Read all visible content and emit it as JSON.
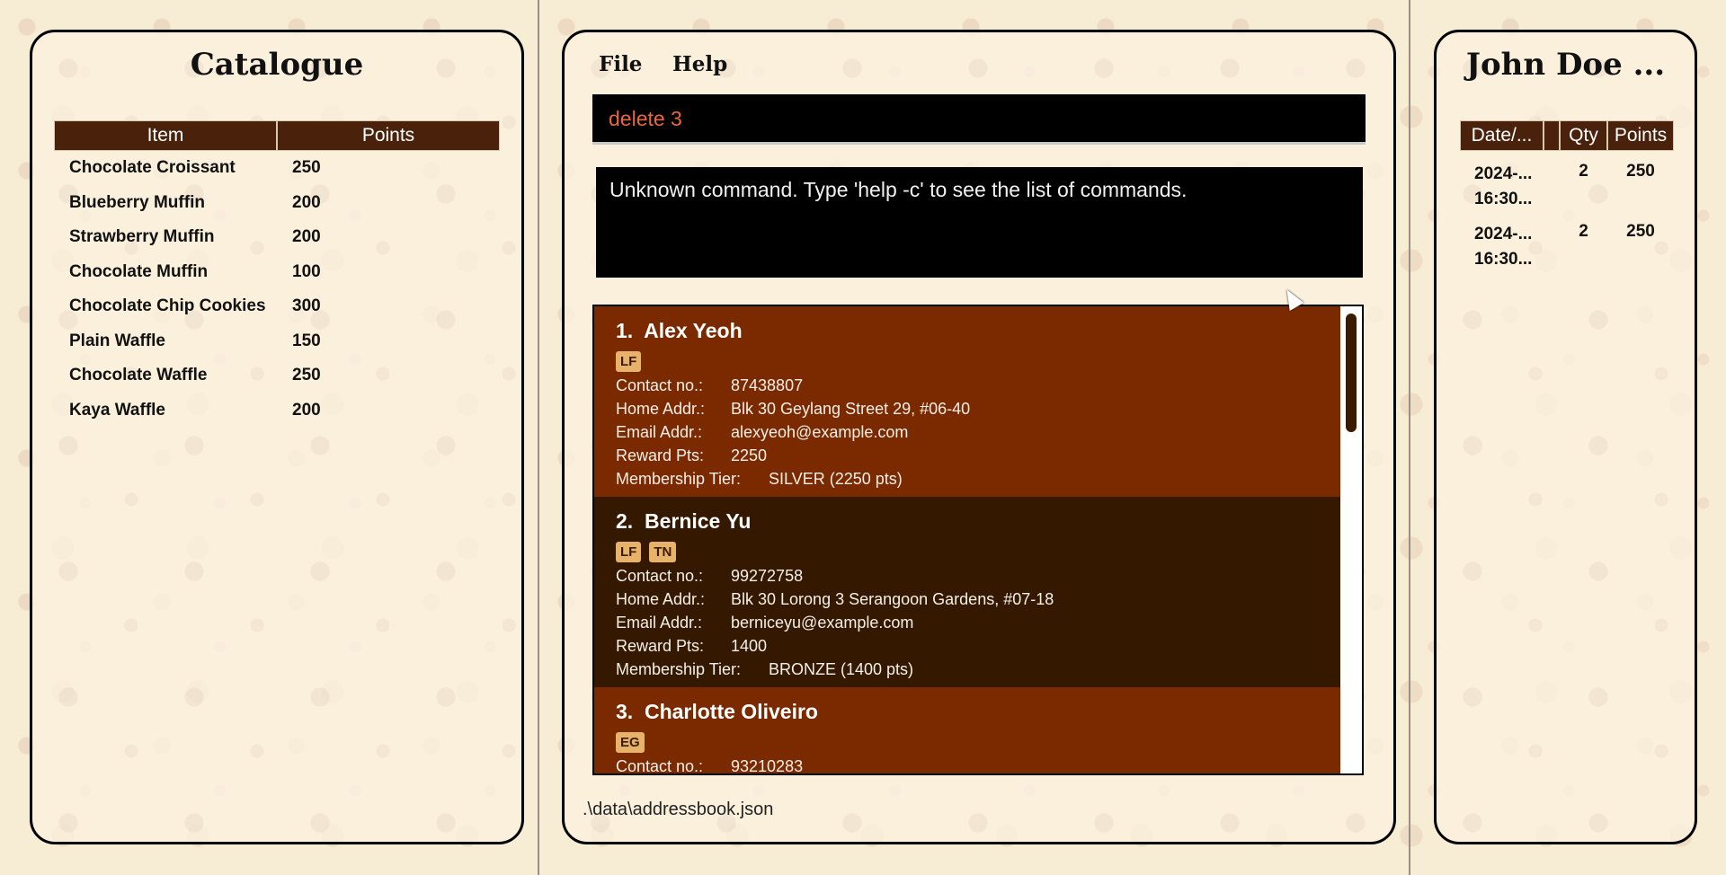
{
  "catalogue": {
    "title": "Catalogue",
    "headers": [
      "Item",
      "Points"
    ],
    "items": [
      {
        "name": "Chocolate Croissant",
        "points": "250"
      },
      {
        "name": "Blueberry Muffin",
        "points": "200"
      },
      {
        "name": "Strawberry Muffin",
        "points": "200"
      },
      {
        "name": "Chocolate Muffin",
        "points": "100"
      },
      {
        "name": "Chocolate Chip Cookies",
        "points": "300"
      },
      {
        "name": "Plain Waffle",
        "points": "150"
      },
      {
        "name": "Chocolate Waffle",
        "points": "250"
      },
      {
        "name": "Kaya Waffle",
        "points": "200"
      }
    ]
  },
  "menu": {
    "file": "File",
    "help": "Help"
  },
  "command": {
    "value": "delete 3"
  },
  "result": {
    "text": "Unknown command. Type 'help -c' to see the list of commands."
  },
  "labels": {
    "contact": "Contact no.:",
    "home": "Home Addr.:",
    "email": "Email Addr.:",
    "reward": "Reward Pts:",
    "tier": "Membership Tier:"
  },
  "persons": [
    {
      "index": "1.",
      "name": "Alex Yeoh",
      "tags": [
        "LF"
      ],
      "contact": "87438807",
      "address": "Blk 30 Geylang Street 29, #06-40",
      "email": "alexyeoh@example.com",
      "points": "2250",
      "tier": "SILVER (2250 pts)"
    },
    {
      "index": "2.",
      "name": "Bernice Yu",
      "tags": [
        "LF",
        "TN"
      ],
      "contact": "99272758",
      "address": "Blk 30 Lorong 3 Serangoon Gardens, #07-18",
      "email": "berniceyu@example.com",
      "points": "1400",
      "tier": "BRONZE (1400 pts)"
    },
    {
      "index": "3.",
      "name": "Charlotte Oliveiro",
      "tags": [
        "EG"
      ],
      "contact": "93210283"
    }
  ],
  "status": {
    "path": ".\\data\\addressbook.json"
  },
  "history": {
    "title": "John Doe ...",
    "headers": [
      "Date/...",
      "",
      "Qty",
      "Points"
    ],
    "rows": [
      {
        "date1": "2024-...",
        "date2": "16:30...",
        "qty": "2",
        "points": "250"
      },
      {
        "date1": "2024-...",
        "date2": "16:30...",
        "qty": "2",
        "points": "250"
      }
    ]
  }
}
